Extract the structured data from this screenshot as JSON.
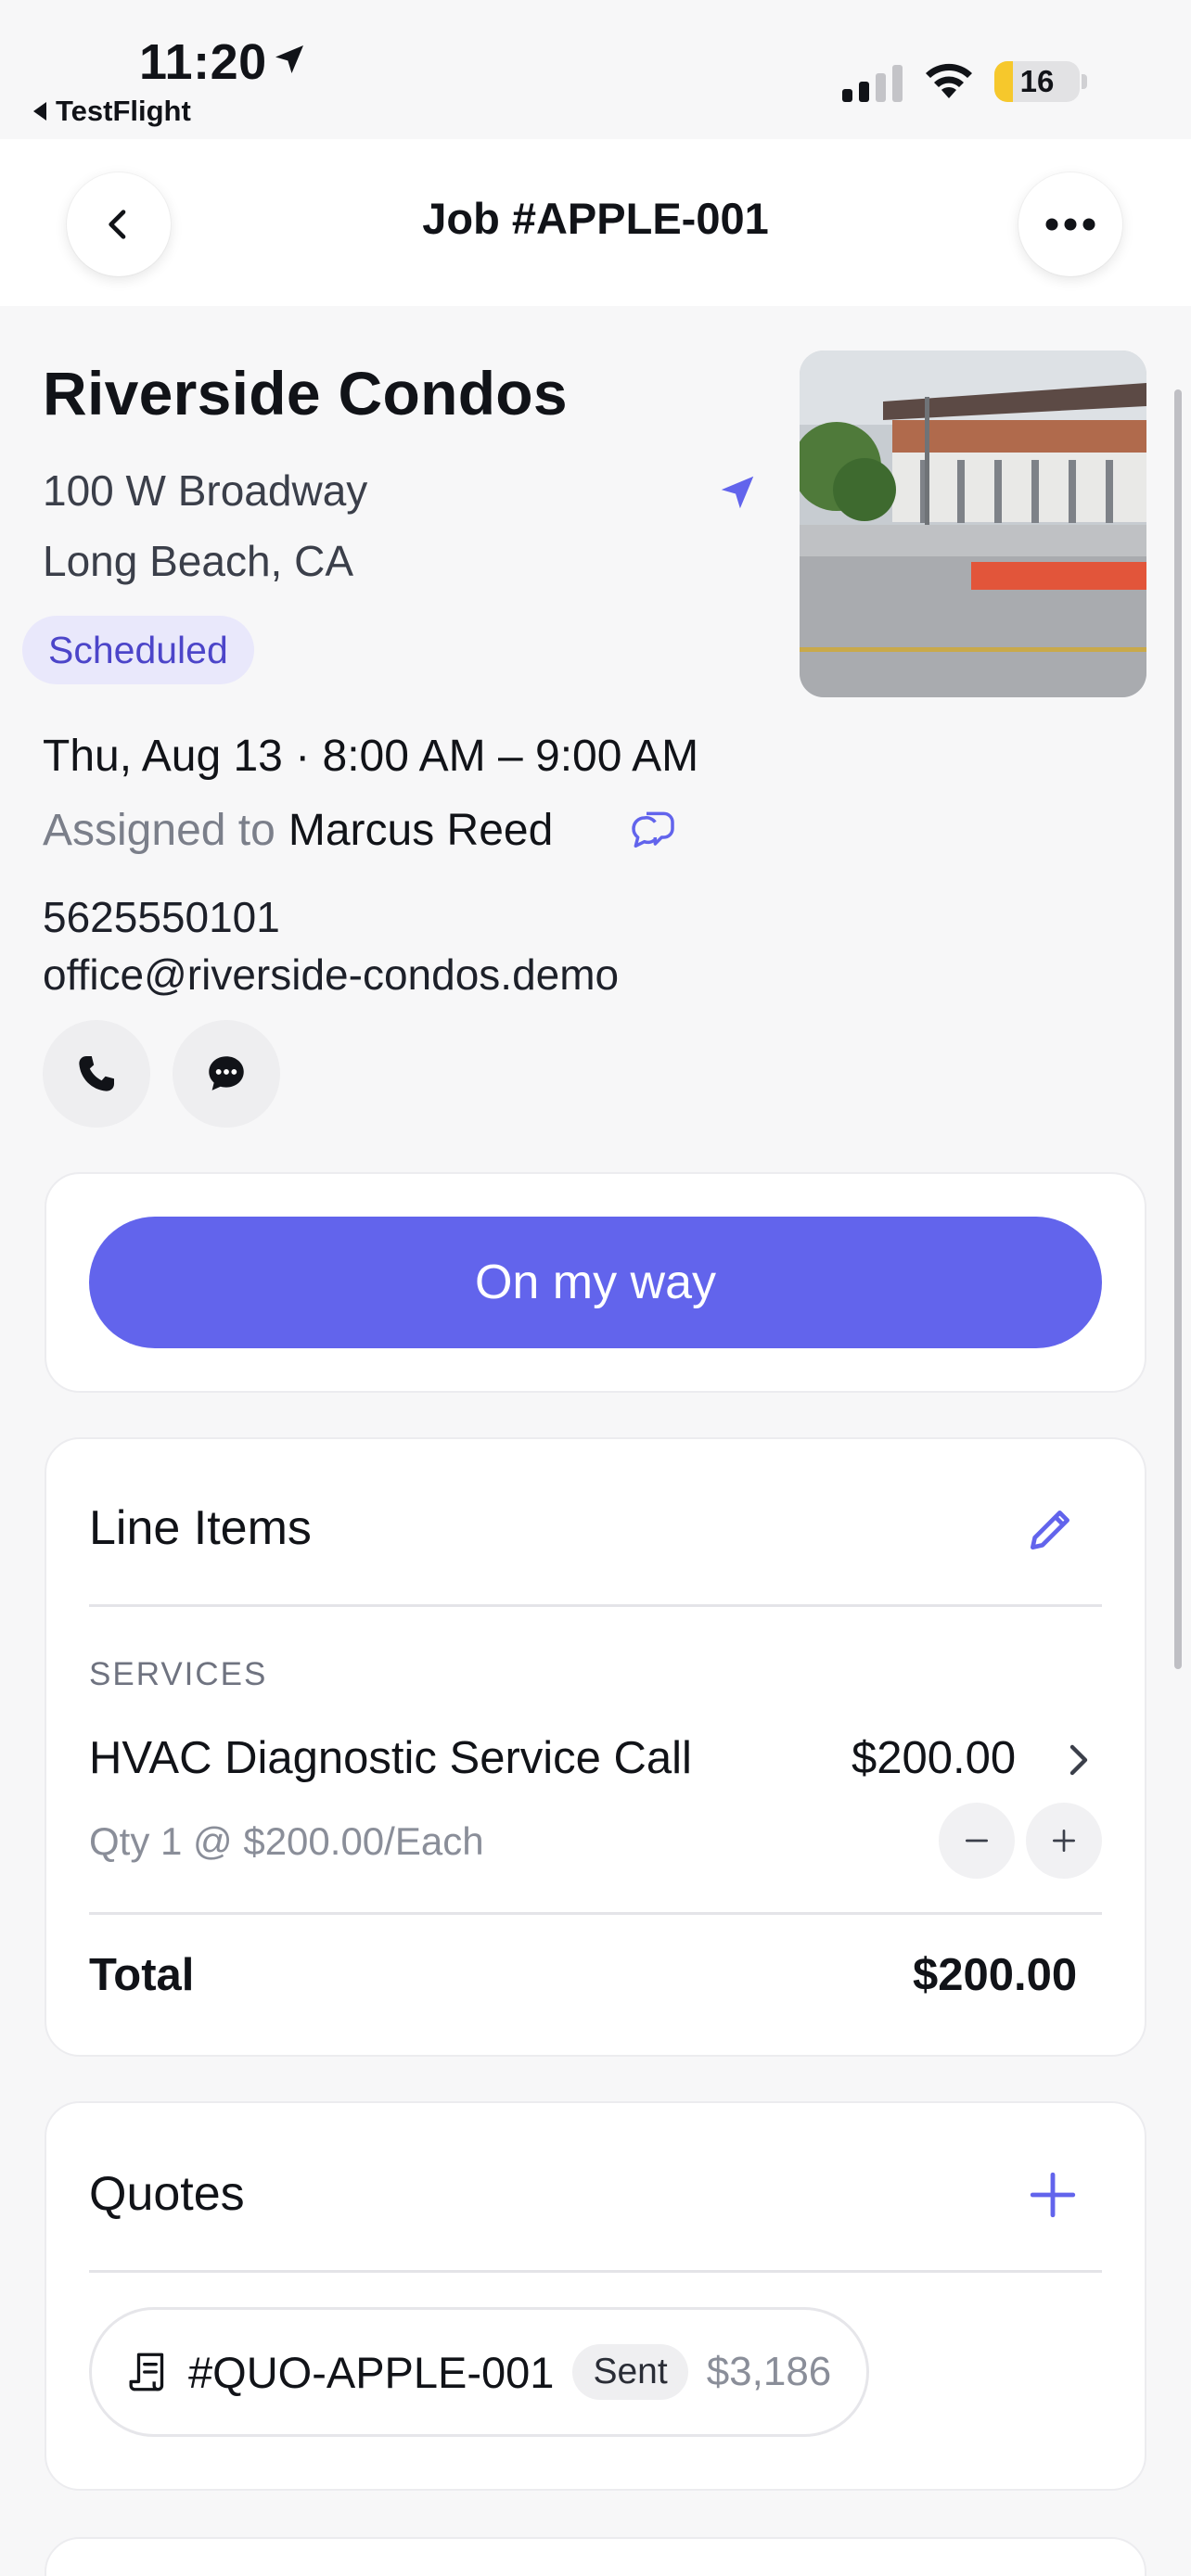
{
  "status_bar": {
    "time": "11:20",
    "back_app": "TestFlight",
    "battery": "16"
  },
  "nav": {
    "title": "Job #APPLE-001"
  },
  "job": {
    "name": "Riverside Condos",
    "address_line1": "100 W Broadway",
    "address_line2": "Long Beach, CA",
    "status": "Scheduled",
    "datetime": "Thu, Aug 13 · 8:00 AM – 9:00 AM",
    "assigned_label": "Assigned to",
    "assigned_name": "Marcus Reed",
    "phone": "5625550101",
    "email": "office@riverside-condos.demo"
  },
  "actions": {
    "on_my_way": "On my way"
  },
  "line_items": {
    "title": "Line Items",
    "section": "SERVICES",
    "items": [
      {
        "name": "HVAC Diagnostic Service Call",
        "price": "$200.00",
        "qty": "Qty 1 @ $200.00/Each"
      }
    ],
    "total_label": "Total",
    "total_value": "$200.00"
  },
  "quotes": {
    "title": "Quotes",
    "items": [
      {
        "number": "#QUO-APPLE-001",
        "status": "Sent",
        "amount": "$3,186"
      }
    ]
  },
  "colors": {
    "accent": "#6264ec",
    "status_pill_bg": "#e9e8fb",
    "status_pill_text": "#4c45c9",
    "battery_fill": "#f6c82c"
  },
  "icons": {
    "status": [
      "location-arrow-icon",
      "signal-icon",
      "wifi-icon",
      "battery-icon"
    ],
    "nav": [
      "chevron-left-icon",
      "more-icon"
    ],
    "job": [
      "navigate-icon",
      "chat-bubbles-icon",
      "phone-icon",
      "message-icon"
    ],
    "line_items": [
      "pencil-icon",
      "chevron-right-icon",
      "minus-icon",
      "plus-icon"
    ],
    "quotes": [
      "plus-icon",
      "document-icon"
    ]
  }
}
